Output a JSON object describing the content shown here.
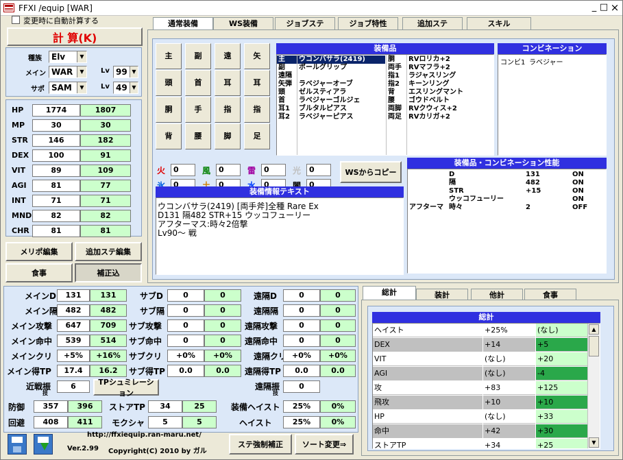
{
  "window": {
    "title": "FFXI /equip [WAR]",
    "min": "_",
    "max": "□",
    "close": "×"
  },
  "auto_calc_label": "変更時に自動計算する",
  "calc_button": "計 算(K)",
  "char": {
    "race_label": "種族",
    "race_value": "Elv",
    "main_label": "メイン",
    "main_value": "WAR",
    "sub_label": "サポ",
    "sub_value": "SAM",
    "lv_label": "Lv",
    "main_lv": "99",
    "sub_lv": "49"
  },
  "stats": [
    {
      "name": "HP",
      "base": "1774",
      "total": "1807"
    },
    {
      "name": "MP",
      "base": "30",
      "total": "30"
    },
    {
      "name": "STR",
      "base": "146",
      "total": "182"
    },
    {
      "name": "DEX",
      "base": "100",
      "total": "91"
    },
    {
      "name": "VIT",
      "base": "89",
      "total": "109"
    },
    {
      "name": "AGI",
      "base": "81",
      "total": "77"
    },
    {
      "name": "INT",
      "base": "71",
      "total": "71"
    },
    {
      "name": "MND",
      "base": "82",
      "total": "82"
    },
    {
      "name": "CHR",
      "base": "81",
      "total": "81"
    }
  ],
  "left_buttons": {
    "merit": "メリポ編集",
    "addstat": "追加ステ編集",
    "food": "食事",
    "correction": "補正込"
  },
  "tabs": [
    "通常装備",
    "WS装備",
    "ジョブステ",
    "ジョブ特性",
    "追加ステ",
    "スキル"
  ],
  "slots": [
    "主",
    "副",
    "遠",
    "矢",
    "頭",
    "首",
    "耳",
    "耳",
    "胴",
    "手",
    "指",
    "指",
    "背",
    "腰",
    "脚",
    "足"
  ],
  "equip_header": "装備品",
  "equip_left": [
    {
      "slot": "主",
      "item": "ウコンバサラ(2419)"
    },
    {
      "slot": "副",
      "item": "ポールグリップ"
    },
    {
      "slot": "遠隔",
      "item": ""
    },
    {
      "slot": "矢弾",
      "item": "ラベジャーオーブ"
    },
    {
      "slot": "頭",
      "item": "ゼルスティアラ"
    },
    {
      "slot": "首",
      "item": "ラベジャーゴルジェ"
    },
    {
      "slot": "耳1",
      "item": "ブルタルピアス"
    },
    {
      "slot": "耳2",
      "item": "ラベジャーピアス"
    }
  ],
  "equip_right": [
    {
      "slot": "胴",
      "item": "RVロリカ+2"
    },
    {
      "slot": "両手",
      "item": "RVマフラ+2"
    },
    {
      "slot": "指1",
      "item": "ラジャスリング"
    },
    {
      "slot": "指2",
      "item": "キーンリング"
    },
    {
      "slot": "背",
      "item": "エスリングマント"
    },
    {
      "slot": "腰",
      "item": "ゴウドベルト"
    },
    {
      "slot": "両脚",
      "item": "RVクウィス+2"
    },
    {
      "slot": "両足",
      "item": "RVカリガ+2"
    }
  ],
  "combi_header": "コンビネーション",
  "combi": {
    "label": "コンビ1",
    "value": "ラベジャー"
  },
  "elements": [
    {
      "name": "火",
      "value": "0",
      "color": "#e00000"
    },
    {
      "name": "風",
      "value": "0",
      "color": "#008000"
    },
    {
      "name": "雷",
      "value": "0",
      "color": "#a000a0"
    },
    {
      "name": "光",
      "value": "0",
      "color": "#c0c0c0"
    },
    {
      "name": "氷",
      "value": "0",
      "color": "#0060e0"
    },
    {
      "name": "土",
      "value": "0",
      "color": "#d08000"
    },
    {
      "name": "水",
      "value": "0",
      "color": "#0040ff"
    },
    {
      "name": "闇",
      "value": "0",
      "color": "#000000"
    }
  ],
  "ws_copy_button": "WSからコピー",
  "combi_perf_header": "装備品・コンビネーション性能",
  "combi_perf": [
    {
      "a": "",
      "b": "D",
      "c": "131",
      "d": "ON"
    },
    {
      "a": "",
      "b": "隔",
      "c": "482",
      "d": "ON"
    },
    {
      "a": "",
      "b": "STR",
      "c": "+15",
      "d": "ON"
    },
    {
      "a": "",
      "b": "ウッコフューリー",
      "c": "",
      "d": "ON"
    },
    {
      "a": "アフターマ",
      "b": "時々",
      "c": "2",
      "d": "OFF"
    }
  ],
  "equip_text_header": "装備情報テキスト",
  "equip_text": [
    "ウコンバサラ(2419) [両手斧]全種 Rare Ex",
    "D131 隔482 STR+15 ウッコフューリー",
    "アフターマス:時々2倍撃",
    "Lv90～ 戦"
  ],
  "combat": {
    "rows": [
      {
        "l1": "メインD",
        "v1": "131",
        "v2": "131",
        "l2": "サブD",
        "v3": "0",
        "v4": "0",
        "l3": "遠隔D",
        "v5": "0",
        "v6": "0"
      },
      {
        "l1": "メイン隔",
        "v1": "482",
        "v2": "482",
        "l2": "サブ隔",
        "v3": "0",
        "v4": "0",
        "l3": "遠隔隔",
        "v5": "0",
        "v6": "0"
      },
      {
        "l1": "メイン攻撃",
        "v1": "647",
        "v2": "709",
        "l2": "サブ攻撃",
        "v3": "0",
        "v4": "0",
        "l3": "遠隔攻撃",
        "v5": "0",
        "v6": "0"
      },
      {
        "l1": "メイン命中",
        "v1": "539",
        "v2": "514",
        "l2": "サブ命中",
        "v3": "0",
        "v4": "0",
        "l3": "遠隔命中",
        "v5": "0",
        "v6": "0"
      },
      {
        "l1": "メインクリ",
        "v1": "+5%",
        "v2": "+16%",
        "l2": "サブクリ",
        "v3": "+0%",
        "v4": "+0%",
        "l3": "遠隔クリ",
        "v5": "+0%",
        "v6": "+0%"
      },
      {
        "l1": "メイン得TP",
        "v1": "17.4",
        "v2": "16.2",
        "l2": "サブ得TP",
        "v3": "0.0",
        "v4": "0.0",
        "l3": "遠隔得TP",
        "v5": "0.0",
        "v6": "0.0"
      }
    ],
    "melee_skill_label": "近戦振",
    "melee_skill_sub": "技",
    "melee_skill_value": "6",
    "tp_sim_button": "TPシュミレーション",
    "ranged_skill_label": "遠隔振",
    "ranged_skill_sub": "技",
    "ranged_skill_value": "0",
    "def_label": "防御",
    "def_v1": "357",
    "def_v2": "396",
    "storetp_label": "ストアTP",
    "storetp_v1": "34",
    "storetp_v2": "25",
    "eqhaste_label": "装備ヘイスト",
    "eqhaste_v1": "25%",
    "eqhaste_v2": "0%",
    "eva_label": "回避",
    "eva_v1": "408",
    "eva_v2": "411",
    "mokusha_label": "モクシャ",
    "mokusha_v1": "5",
    "mokusha_v2": "5",
    "haste_label": "ヘイスト",
    "haste_v1": "25%",
    "haste_v2": "0%"
  },
  "footer": {
    "url": "http://ffxiequip.ran-maru.net/",
    "version": "Ver.2.99",
    "copyright": "Copyright(C) 2010 by ガル",
    "force_btn": "ステ強制補正",
    "sort_btn": "ソート変更⇒"
  },
  "sum_tabs": [
    "総計",
    "装計",
    "他計",
    "食事"
  ],
  "sum_header": "総計",
  "sum_rows": [
    {
      "name": "ヘイスト",
      "a": "+25%",
      "b": "(なし)",
      "hl": false
    },
    {
      "name": "DEX",
      "a": "+14",
      "b": "+5",
      "hl": true
    },
    {
      "name": "VIT",
      "a": "(なし)",
      "b": "+20",
      "hl": false
    },
    {
      "name": "AGI",
      "a": "(なし)",
      "b": "-4",
      "hl": true
    },
    {
      "name": "攻",
      "a": "+83",
      "b": "+125",
      "hl": false
    },
    {
      "name": "飛攻",
      "a": "+10",
      "b": "+10",
      "hl": true
    },
    {
      "name": "HP",
      "a": "(なし)",
      "b": "+33",
      "hl": false
    },
    {
      "name": "命中",
      "a": "+42",
      "b": "+30",
      "hl": true
    },
    {
      "name": "ストアTP",
      "a": "+34",
      "b": "+25",
      "hl": false
    }
  ]
}
